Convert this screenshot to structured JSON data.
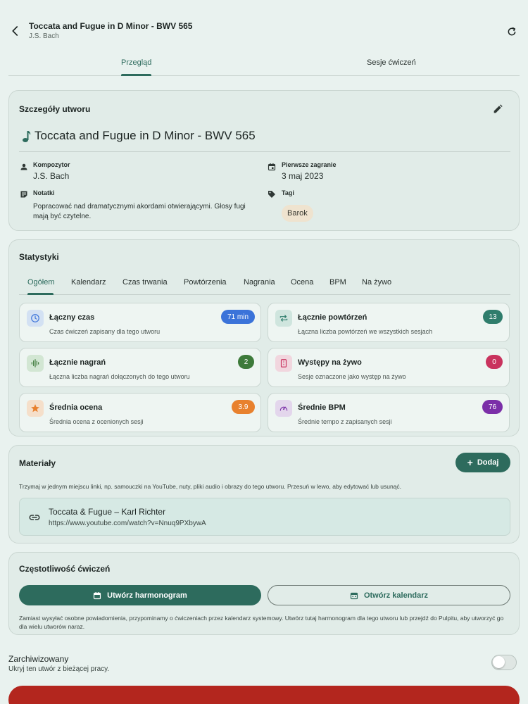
{
  "header": {
    "title": "Toccata and Fugue in D Minor - BWV 565",
    "subtitle": "J.S. Bach",
    "back_icon": "arrow-left-icon",
    "refresh_icon": "refresh-icon"
  },
  "tabs": [
    {
      "label": "Przegląd",
      "active": true
    },
    {
      "label": "Sesje ćwiczeń",
      "active": false
    }
  ],
  "details": {
    "card_title": "Szczegóły utworu",
    "piece_title": "Toccata and Fugue in D Minor - BWV 565",
    "composer_label": "Kompozytor",
    "composer_value": "J.S. Bach",
    "first_played_label": "Pierwsze zagranie",
    "first_played_value": "3 maj 2023",
    "notes_label": "Notatki",
    "notes_value": "Popracować nad dramatycznymi akordami otwierającymi. Głosy fugi mają być czytelne.",
    "tags_label": "Tagi",
    "tags": [
      "Barok"
    ]
  },
  "stats": {
    "card_title": "Statystyki",
    "tabs": [
      "Ogółem",
      "Kalendarz",
      "Czas trwania",
      "Powtórzenia",
      "Nagrania",
      "Ocena",
      "BPM",
      "Na żywo"
    ],
    "items": [
      {
        "title": "Łączny czas",
        "desc": "Czas ćwiczeń zapisany dla tego utworu",
        "value": "71 min",
        "color": "#3b73d9",
        "icon_bg": "#d3e1f3"
      },
      {
        "title": "Łącznie powtórzeń",
        "desc": "Łączna liczba powtórzeń we wszystkich sesjach",
        "value": "13",
        "color": "#2f7d6c",
        "icon_bg": "#cfe5de"
      },
      {
        "title": "Łącznie nagrań",
        "desc": "Łączna liczba nagrań dołączonych do tego utworu",
        "value": "2",
        "color": "#3d7a3a",
        "icon_bg": "#d2e6d3"
      },
      {
        "title": "Występy na żywo",
        "desc": "Sesje oznaczone jako występ na żywo",
        "value": "0",
        "color": "#c9335e",
        "icon_bg": "#f1d6de"
      },
      {
        "title": "Średnia ocena",
        "desc": "Średnia ocena z ocenionych sesji",
        "value": "3.9",
        "color": "#e8812e",
        "icon_bg": "#f5dfca"
      },
      {
        "title": "Średnie BPM",
        "desc": "Średnie tempo z zapisanych sesji",
        "value": "76",
        "color": "#7b2fa8",
        "icon_bg": "#e3d6ec"
      }
    ]
  },
  "materials": {
    "card_title": "Materiały",
    "add_label": "Dodaj",
    "description": "Trzymaj w jednym miejscu linki, np. samouczki na YouTube, nuty, pliki audio i obrazy do tego utworu. Przesuń w lewo, aby edytować lub usunąć.",
    "items": [
      {
        "title": "Toccata & Fugue – Karl Richter",
        "url": "https://www.youtube.com/watch?v=Nnuq9PXbywA"
      }
    ]
  },
  "frequency": {
    "card_title": "Częstotliwość ćwiczeń",
    "create_label": "Utwórz harmonogram",
    "open_label": "Otwórz kalendarz",
    "description": "Zamiast wysyłać osobne powiadomienia, przypominamy o ćwiczeniach przez kalendarz systemowy. Utwórz tutaj harmonogram dla tego utworu lub przejdź do Pulpitu, aby utworzyć go dla wielu utworów naraz."
  },
  "archive": {
    "title": "Zarchiwizowany",
    "subtitle": "Ukryj ten utwór z bieżącej pracy.",
    "enabled": false
  },
  "colors": {
    "primary": "#2d6b5d",
    "danger": "#b3261e",
    "background": "#e9f2ef"
  }
}
